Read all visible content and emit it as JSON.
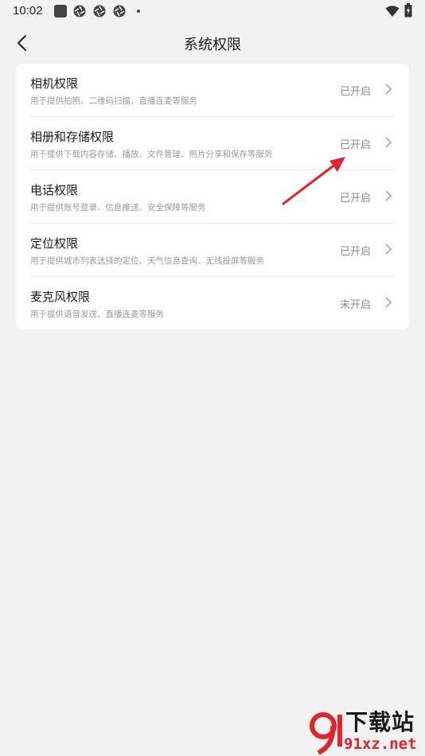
{
  "status_bar": {
    "time": "10:02"
  },
  "header": {
    "title": "系统权限"
  },
  "permissions": [
    {
      "title": "相机权限",
      "desc": "用于提供拍照、二维码扫描、直播连麦等服务",
      "status": "已开启"
    },
    {
      "title": "相册和存储权限",
      "desc": "用于提供下载内容存储、播放、文件管理、照片分享和保存等服务",
      "status": "已开启"
    },
    {
      "title": "电话权限",
      "desc": "用于提供账号登录、信息推送、安全保障等服务",
      "status": "已开启"
    },
    {
      "title": "定位权限",
      "desc": "用于提供城市列表选择的定位、天气信息查询、无线投屏等服务",
      "status": "已开启"
    },
    {
      "title": "麦克风权限",
      "desc": "用于提供语音发送、直播连麦等服务",
      "status": "未开启"
    }
  ],
  "watermark": {
    "brand": "下载站",
    "site": "91xz.net"
  },
  "colors": {
    "background": "#f2f2f2",
    "card": "#ffffff",
    "annotation_arrow": "#e0242a"
  }
}
